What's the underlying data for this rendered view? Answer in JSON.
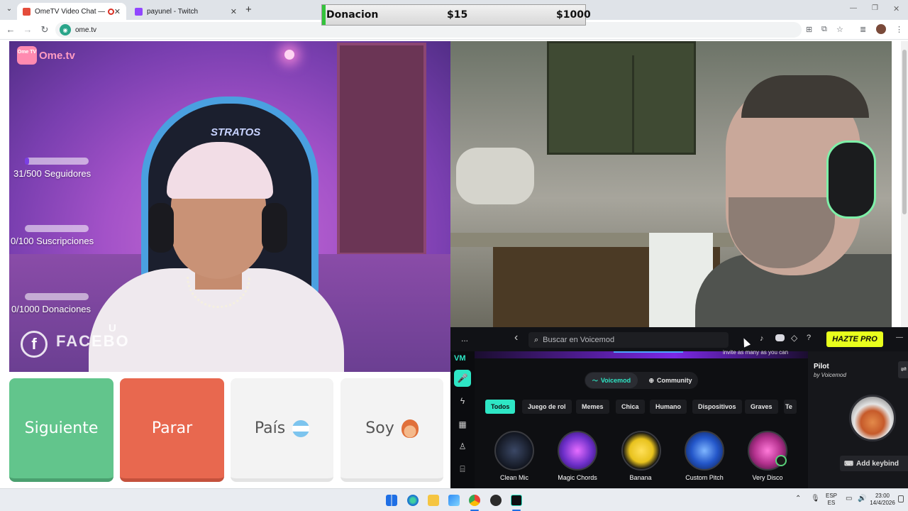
{
  "browser": {
    "tabs": [
      {
        "label": "OmeTV Video Chat — Ome",
        "active": true
      },
      {
        "label": "payunel - Twitch",
        "active": false
      }
    ],
    "new_tab": "+",
    "url": "ome.tv",
    "tab_list_icon": "chevron-down-icon"
  },
  "donation_overlay": {
    "label": "Donacion",
    "current": "$15",
    "goal": "$1000"
  },
  "left_video": {
    "logo_text": "Ome.tv",
    "logo_badge": "Ome TV",
    "chair_text": "STRATOS",
    "watermark_text": "FACEBO",
    "watermark_sup": "U",
    "goals": [
      {
        "label": "31/500 Seguidores",
        "progress": 0.062
      },
      {
        "label": "0/100 Suscripciones",
        "progress": 0
      },
      {
        "label": "0/1000 Donaciones",
        "progress": 0
      }
    ]
  },
  "ome_buttons": {
    "next": "Siguiente",
    "stop": "Parar",
    "country": "País",
    "country_flag": "🇦🇷",
    "gender": "Soy",
    "gender_emoji": "🧑"
  },
  "voicemod": {
    "menu": "...",
    "back": "‹",
    "search_placeholder": "Buscar en Voicemod",
    "pro_button": "HAZTE PRO",
    "minimize": "—",
    "banner_text": "invite as many as you can",
    "source_tabs": [
      "Voicemod",
      "Community"
    ],
    "categories": [
      "Todos",
      "Juego de rol",
      "Memes",
      "Chica",
      "Humano",
      "Dispositivos",
      "Graves",
      "Te"
    ],
    "voices": [
      {
        "name": "Clean Mic",
        "color": "#2a3345"
      },
      {
        "name": "Magic Chords",
        "color": "#6d2fc9"
      },
      {
        "name": "Banana",
        "color": "#e8c21d"
      },
      {
        "name": "Custom Pitch",
        "color": "#2356c9"
      },
      {
        "name": "Very Disco",
        "color": "#b5328f"
      }
    ],
    "selected_voice": {
      "name": "Pilot",
      "by": "by Voicemod"
    },
    "keybind": "Add keybind",
    "colors": {
      "accent": "#2ee6c5",
      "pro": "#e8ff1d",
      "banner": "#7b28e6"
    }
  },
  "taskbar": {
    "lang": "ESP",
    "lang_sub": "ES",
    "time": "23:00",
    "date": "14/4/2026"
  }
}
